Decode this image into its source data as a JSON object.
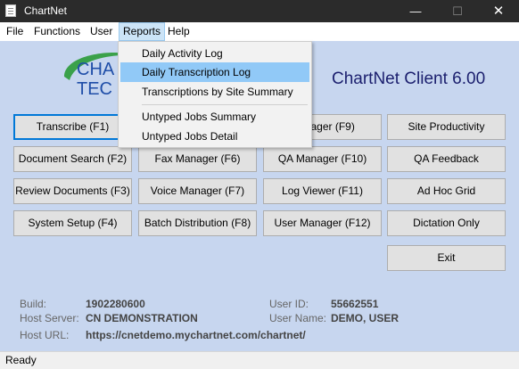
{
  "window": {
    "title": "ChartNet"
  },
  "menubar": {
    "items": [
      {
        "label": "File"
      },
      {
        "label": "Functions"
      },
      {
        "label": "User"
      },
      {
        "label": "Reports"
      },
      {
        "label": "Help"
      }
    ]
  },
  "reports_menu": {
    "items": [
      "Daily Activity Log",
      "Daily Transcription Log",
      "Transcriptions by Site Summary",
      "Untyped Jobs Summary",
      "Untyped Jobs Detail"
    ],
    "highlighted_index": 1
  },
  "logo": {
    "line1": "CHA",
    "line2": "TEC"
  },
  "product_title": "ChartNet Client 6.00",
  "buttons": {
    "transcribe": "Transcribe (F1)",
    "manager_f9": "Manager (F9)",
    "site_productivity": "Site Productivity",
    "document_search": "Document Search (F2)",
    "fax_manager": "Fax Manager (F6)",
    "qa_manager": "QA Manager (F10)",
    "qa_feedback": "QA Feedback",
    "review_documents": "Review Documents (F3)",
    "voice_manager": "Voice Manager (F7)",
    "log_viewer": "Log Viewer (F11)",
    "ad_hoc_grid": "Ad Hoc Grid",
    "system_setup": "System Setup (F4)",
    "batch_distribution": "Batch Distribution  (F8)",
    "user_manager": "User Manager (F12)",
    "dictation_only": "Dictation Only",
    "exit": "Exit"
  },
  "info": {
    "build_label": "Build:",
    "build_value": "1902280600",
    "host_server_label": "Host Server:",
    "host_server_value": "CN DEMONSTRATION",
    "host_url_label": "Host URL:",
    "host_url_value": "https://cnetdemo.mychartnet.com/chartnet/",
    "user_id_label": "User ID:",
    "user_id_value": "55662551",
    "user_name_label": "User Name:",
    "user_name_value": "DEMO, USER"
  },
  "status": {
    "text": "Ready"
  },
  "colors": {
    "background": "#c7d6ef",
    "title_text": "#1b1f6e",
    "menu_highlight": "#91c9f7"
  }
}
